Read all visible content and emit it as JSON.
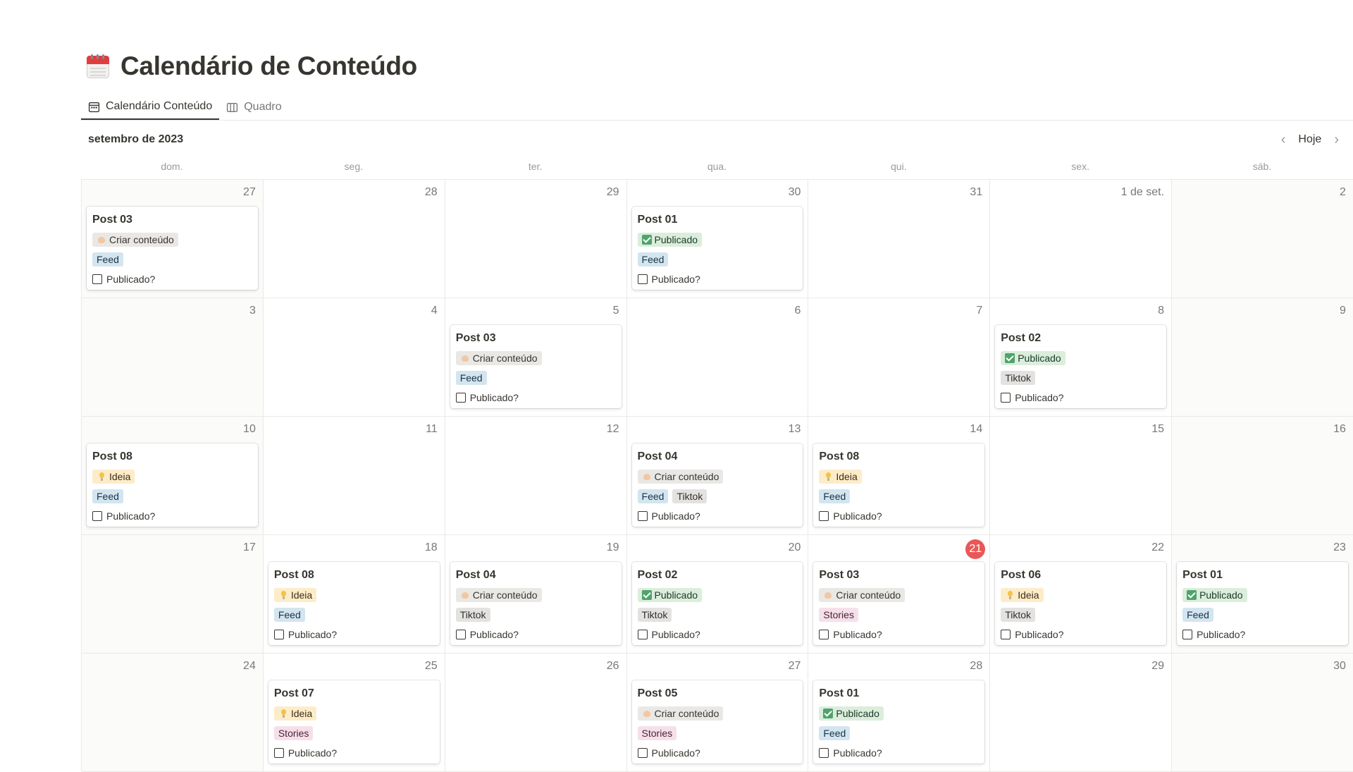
{
  "page": {
    "title": "Calendário de Conteúdo"
  },
  "tabs": [
    {
      "label": "Calendário Conteúdo",
      "icon": "calendar-icon",
      "active": true
    },
    {
      "label": "Quadro",
      "icon": "board-icon",
      "active": false
    }
  ],
  "calendar": {
    "month_label": "setembro de 2023",
    "today_label": "Hoje",
    "weekdays": [
      "dom.",
      "seg.",
      "ter.",
      "qua.",
      "qui.",
      "sex.",
      "sáb."
    ],
    "checkbox_label": "Publicado?",
    "today_day": "21",
    "days": [
      {
        "num": "27",
        "cards": [
          {
            "title": "Post 03",
            "status": "Criar conteúdo",
            "status_icon": "arm-icon",
            "channels": [
              "Feed"
            ]
          }
        ]
      },
      {
        "num": "28",
        "cards": []
      },
      {
        "num": "29",
        "cards": []
      },
      {
        "num": "30",
        "cards": [
          {
            "title": "Post 01",
            "status": "Publicado",
            "status_icon": "check-icon",
            "channels": [
              "Feed"
            ]
          }
        ]
      },
      {
        "num": "31",
        "cards": []
      },
      {
        "num": "1 de set.",
        "cards": []
      },
      {
        "num": "2",
        "cards": []
      },
      {
        "num": "3",
        "cards": []
      },
      {
        "num": "4",
        "cards": []
      },
      {
        "num": "5",
        "cards": [
          {
            "title": "Post 03",
            "status": "Criar conteúdo",
            "status_icon": "arm-icon",
            "channels": [
              "Feed"
            ]
          }
        ]
      },
      {
        "num": "6",
        "cards": []
      },
      {
        "num": "7",
        "cards": []
      },
      {
        "num": "8",
        "cards": [
          {
            "title": "Post 02",
            "status": "Publicado",
            "status_icon": "check-icon",
            "channels": [
              "Tiktok"
            ]
          }
        ]
      },
      {
        "num": "9",
        "cards": []
      },
      {
        "num": "10",
        "cards": [
          {
            "title": "Post 08",
            "status": "Ideia",
            "status_icon": "bulb-icon",
            "channels": [
              "Feed"
            ]
          }
        ]
      },
      {
        "num": "11",
        "cards": []
      },
      {
        "num": "12",
        "cards": []
      },
      {
        "num": "13",
        "cards": [
          {
            "title": "Post 04",
            "status": "Criar conteúdo",
            "status_icon": "arm-icon",
            "channels": [
              "Feed",
              "Tiktok"
            ]
          }
        ]
      },
      {
        "num": "14",
        "cards": [
          {
            "title": "Post 08",
            "status": "Ideia",
            "status_icon": "bulb-icon",
            "channels": [
              "Feed"
            ]
          }
        ]
      },
      {
        "num": "15",
        "cards": []
      },
      {
        "num": "16",
        "cards": []
      },
      {
        "num": "17",
        "cards": []
      },
      {
        "num": "18",
        "cards": [
          {
            "title": "Post 08",
            "status": "Ideia",
            "status_icon": "bulb-icon",
            "channels": [
              "Feed"
            ]
          }
        ]
      },
      {
        "num": "19",
        "cards": [
          {
            "title": "Post 04",
            "status": "Criar conteúdo",
            "status_icon": "arm-icon",
            "channels": [
              "Tiktok"
            ]
          }
        ]
      },
      {
        "num": "20",
        "cards": [
          {
            "title": "Post 02",
            "status": "Publicado",
            "status_icon": "check-icon",
            "channels": [
              "Tiktok"
            ]
          }
        ]
      },
      {
        "num": "21",
        "cards": [
          {
            "title": "Post 03",
            "status": "Criar conteúdo",
            "status_icon": "arm-icon",
            "channels": [
              "Stories"
            ]
          }
        ]
      },
      {
        "num": "22",
        "cards": [
          {
            "title": "Post 06",
            "status": "Ideia",
            "status_icon": "bulb-icon",
            "channels": [
              "Tiktok"
            ]
          }
        ]
      },
      {
        "num": "23",
        "cards": [
          {
            "title": "Post 01",
            "status": "Publicado",
            "status_icon": "check-icon",
            "channels": [
              "Feed"
            ]
          }
        ]
      },
      {
        "num": "24",
        "cards": []
      },
      {
        "num": "25",
        "cards": [
          {
            "title": "Post 07",
            "status": "Ideia",
            "status_icon": "bulb-icon",
            "channels": [
              "Stories"
            ]
          }
        ]
      },
      {
        "num": "26",
        "cards": []
      },
      {
        "num": "27",
        "cards": [
          {
            "title": "Post 05",
            "status": "Criar conteúdo",
            "status_icon": "arm-icon",
            "channels": [
              "Stories"
            ]
          }
        ]
      },
      {
        "num": "28",
        "cards": [
          {
            "title": "Post 01",
            "status": "Publicado",
            "status_icon": "check-icon",
            "channels": [
              "Feed"
            ]
          }
        ]
      },
      {
        "num": "29",
        "cards": []
      },
      {
        "num": "30",
        "cards": []
      }
    ]
  },
  "colors": {
    "today_badge": "#eb5757",
    "status_publicado": "#dbeddb",
    "status_ideia": "#fdecc8",
    "status_criar": "#e9e8e5",
    "channel_feed": "#d3e5ef",
    "channel_tiktok": "#e3e2e0",
    "channel_stories": "#f5e0e9"
  }
}
